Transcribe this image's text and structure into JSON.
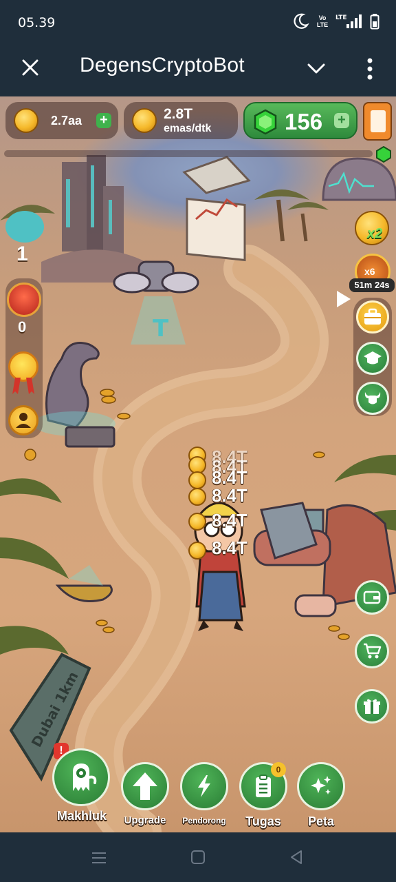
{
  "status_bar": {
    "time": "05.39",
    "icons": [
      "moon-icon",
      "volte-icon",
      "lte-signal-icon",
      "battery-icon"
    ],
    "volte_label": "Vo LTE",
    "lte_label": "LTE"
  },
  "app_bar": {
    "title": "DegensCryptoBot",
    "icons": [
      "close-icon",
      "chevron-down-icon",
      "more-vert-icon"
    ]
  },
  "hud": {
    "coins": "2.7aa",
    "income": "2.8T",
    "income_unit": "emas/dtk",
    "gems": "156"
  },
  "left_panel": {
    "level": "1",
    "chest_count": "0"
  },
  "right_panel": {
    "boost_multiplier": "x2",
    "event_multiplier": "x6",
    "timer": "51m 24s"
  },
  "floating_income": [
    "8.4T",
    "8.4T",
    "8.4T",
    "8.4T",
    "8.4T",
    "8.4T"
  ],
  "scene_text": {
    "sign": "Dubai 1km"
  },
  "bottom_nav": [
    {
      "label": "Makhluk",
      "icon": "monster-icon"
    },
    {
      "label": "Upgrade",
      "icon": "arrow-up-icon"
    },
    {
      "label": "Pendorong",
      "icon": "lightning-icon"
    },
    {
      "label": "Tugas",
      "icon": "clipboard-icon",
      "badge": "0"
    },
    {
      "label": "Peta",
      "icon": "sparkle-map-icon"
    }
  ],
  "alert_badge": "!",
  "colors": {
    "accent_green": "#3fb24c",
    "coin_gold": "#f5b82a",
    "bar_bg": "#1f2e3b",
    "ground": "#d7a67d"
  }
}
